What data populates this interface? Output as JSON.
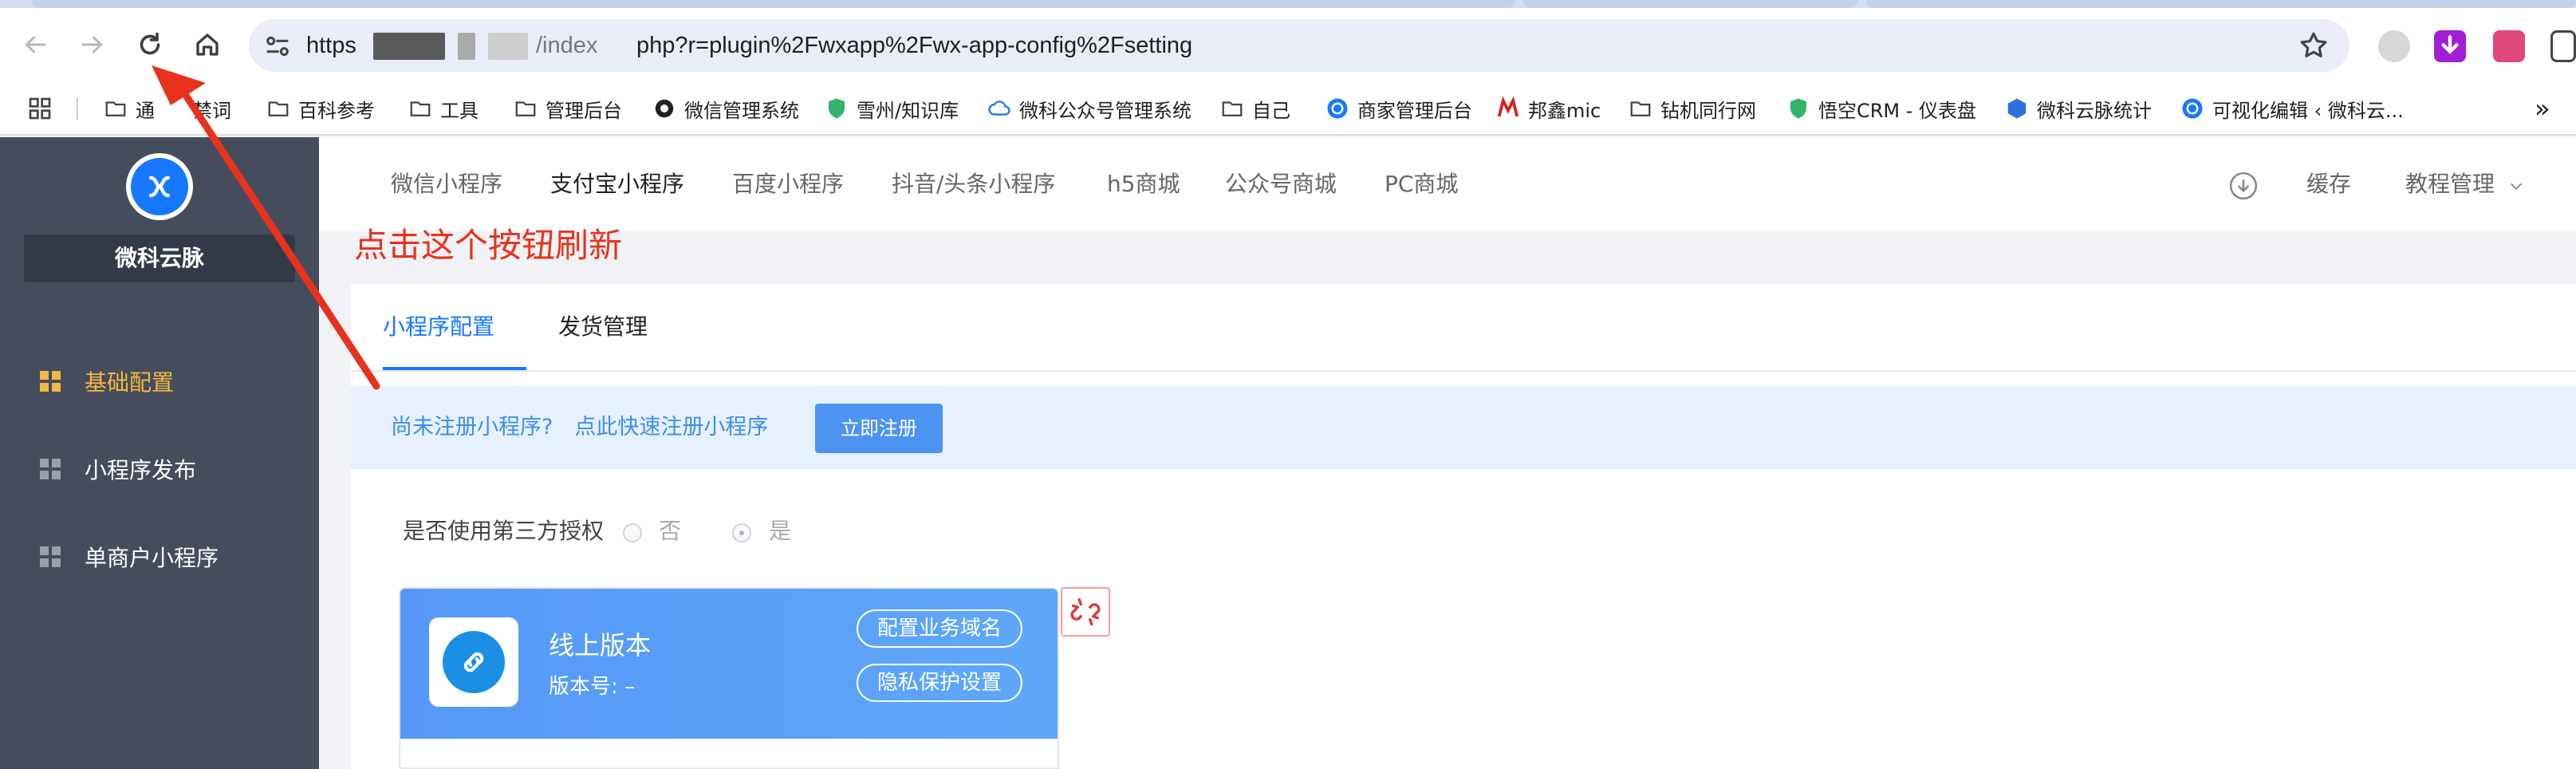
{
  "browser": {
    "url_visible_start": "https",
    "url_visible_end": "php?r=plugin%2Fwxapp%2Fwx-app-config%2Fsetting",
    "url_fragment": "/index",
    "back_icon": "arrow-left-icon",
    "forward_icon": "arrow-right-icon",
    "reload_icon": "reload-icon",
    "home_icon": "home-icon",
    "bookmark_star_icon": "star-icon"
  },
  "bookmarks": {
    "items": [
      {
        "label": "通　　禁词",
        "icon": "folder-icon"
      },
      {
        "label": "百科参考",
        "icon": "folder-icon"
      },
      {
        "label": "工具",
        "icon": "folder-icon"
      },
      {
        "label": "管理后台",
        "icon": "folder-icon"
      },
      {
        "label": "微信管理系统",
        "icon": "globe-icon"
      },
      {
        "label": "雪州/知识库",
        "icon": "shield-icon"
      },
      {
        "label": "微科公众号管理系统",
        "icon": "cloud-icon"
      },
      {
        "label": "自己",
        "icon": "folder-icon"
      },
      {
        "label": "商家管理后台",
        "icon": "logo-icon"
      },
      {
        "label": "邦鑫mic",
        "icon": "m-logo-icon"
      },
      {
        "label": "钻机同行网",
        "icon": "folder-icon"
      },
      {
        "label": "悟空CRM - 仪表盘",
        "icon": "shield-icon"
      },
      {
        "label": "微科云脉统计",
        "icon": "cube-icon"
      },
      {
        "label": "可视化编辑 ‹ 微科云...",
        "icon": "logo-icon"
      }
    ],
    "more": "»"
  },
  "sidebar": {
    "brand": "微科云脉",
    "items": [
      {
        "label": "基础配置",
        "active": true
      },
      {
        "label": "小程序发布",
        "active": false
      },
      {
        "label": "单商户小程序",
        "active": false
      }
    ]
  },
  "topnav": {
    "tabs": [
      {
        "label": "微信小程序",
        "active": false
      },
      {
        "label": "支付宝小程序",
        "active": true
      },
      {
        "label": "百度小程序",
        "active": false
      },
      {
        "label": "抖音/头条小程序",
        "active": false
      },
      {
        "label": "h5商城",
        "active": false
      },
      {
        "label": "公众号商城",
        "active": false
      },
      {
        "label": "PC商城",
        "active": false
      }
    ],
    "cache": "缓存",
    "tutorial": "教程管理"
  },
  "annotation": "点击这个按钮刷新",
  "subtabs": [
    {
      "label": "小程序配置",
      "active": true
    },
    {
      "label": "发货管理",
      "active": false
    }
  ],
  "notice": {
    "text": "尚未注册小程序?　点此快速注册小程序",
    "button": "立即注册"
  },
  "auth": {
    "label": "是否使用第三方授权",
    "options": [
      "否",
      "是"
    ],
    "selected": "是"
  },
  "version_card": {
    "title": "线上版本",
    "version": "版本号: –",
    "actions": [
      "配置业务域名",
      "隐私保护设置"
    ]
  },
  "colors": {
    "accent": "#1677ff",
    "annotation": "#e8321d",
    "sidebar_bg": "#454d5c",
    "sidebar_active": "#f4b840"
  }
}
